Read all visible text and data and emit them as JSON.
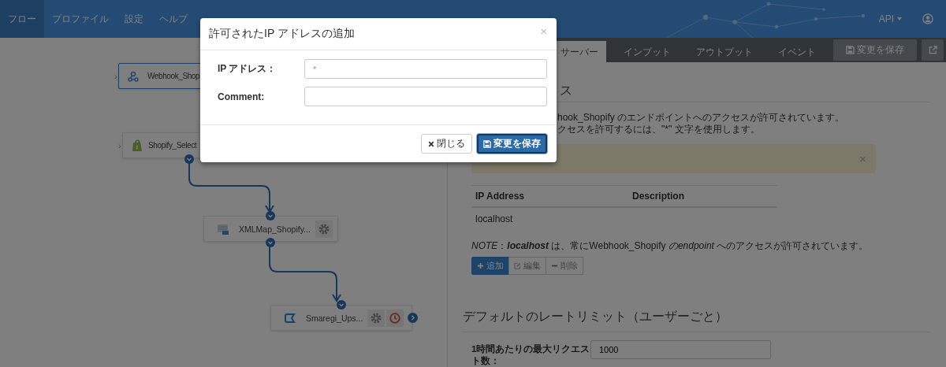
{
  "nav": {
    "items": [
      {
        "label": "フロー",
        "selected": true
      },
      {
        "label": "プロファイル",
        "selected": false
      },
      {
        "label": "設定",
        "selected": false
      },
      {
        "label": "ヘルプ",
        "selected": false
      }
    ],
    "api_menu": "API"
  },
  "flow": {
    "nodes": [
      {
        "label": "Webhook_Shop",
        "kind": "webhook",
        "selected": true,
        "left_port": "›"
      },
      {
        "label": "Shopify_Select",
        "kind": "shopify",
        "selected": false,
        "left_port": "›"
      },
      {
        "label": "XMLMap_Shopify...",
        "kind": "xmlmap",
        "selected": false
      },
      {
        "label": "Smaregi_Ups...",
        "kind": "smaregi",
        "selected": false
      }
    ]
  },
  "panel": {
    "tabs": [
      {
        "label": "サーバー",
        "selected": true
      },
      {
        "label": "インプット",
        "selected": false
      },
      {
        "label": "アウトプット",
        "selected": false
      },
      {
        "label": "イベント",
        "selected": false
      }
    ],
    "save_button": "変更を保存",
    "section_title": "ス",
    "description": [
      "hook_Shopify のエンドポイントへのアクセスが許可されています。",
      "クセスを許可するには、\"*\" 文字を使用します。"
    ],
    "alert": {
      "close": "×"
    },
    "table": {
      "columns": [
        "IP Address",
        "Description"
      ],
      "rows": [
        {
          "ip": "localhost"
        }
      ]
    },
    "note": "*NOTE*：**localhost** は、常にWebhook_Shopify *のendpoint* へのアクセスが許可されています。",
    "actions": [
      {
        "label": "追加",
        "kind": "add"
      },
      {
        "label": "編集",
        "kind": "edit"
      },
      {
        "label": "削除",
        "kind": "delete"
      }
    ],
    "rate_limit": {
      "title": "デフォルトのレートリミット（ユーザーごと）",
      "fields": [
        {
          "label": "1時間あたりの最大リクエスト数：",
          "value": "1000"
        }
      ]
    }
  },
  "modal": {
    "title": "許可されたIP アドレスの追加",
    "close": "×",
    "fields": [
      {
        "label": "IP アドレス：",
        "placeholder": "*"
      },
      {
        "label": "Comment:"
      }
    ],
    "buttons": [
      {
        "label": "閉じる",
        "kind": "close"
      },
      {
        "label": "変更を保存",
        "kind": "save"
      }
    ]
  }
}
